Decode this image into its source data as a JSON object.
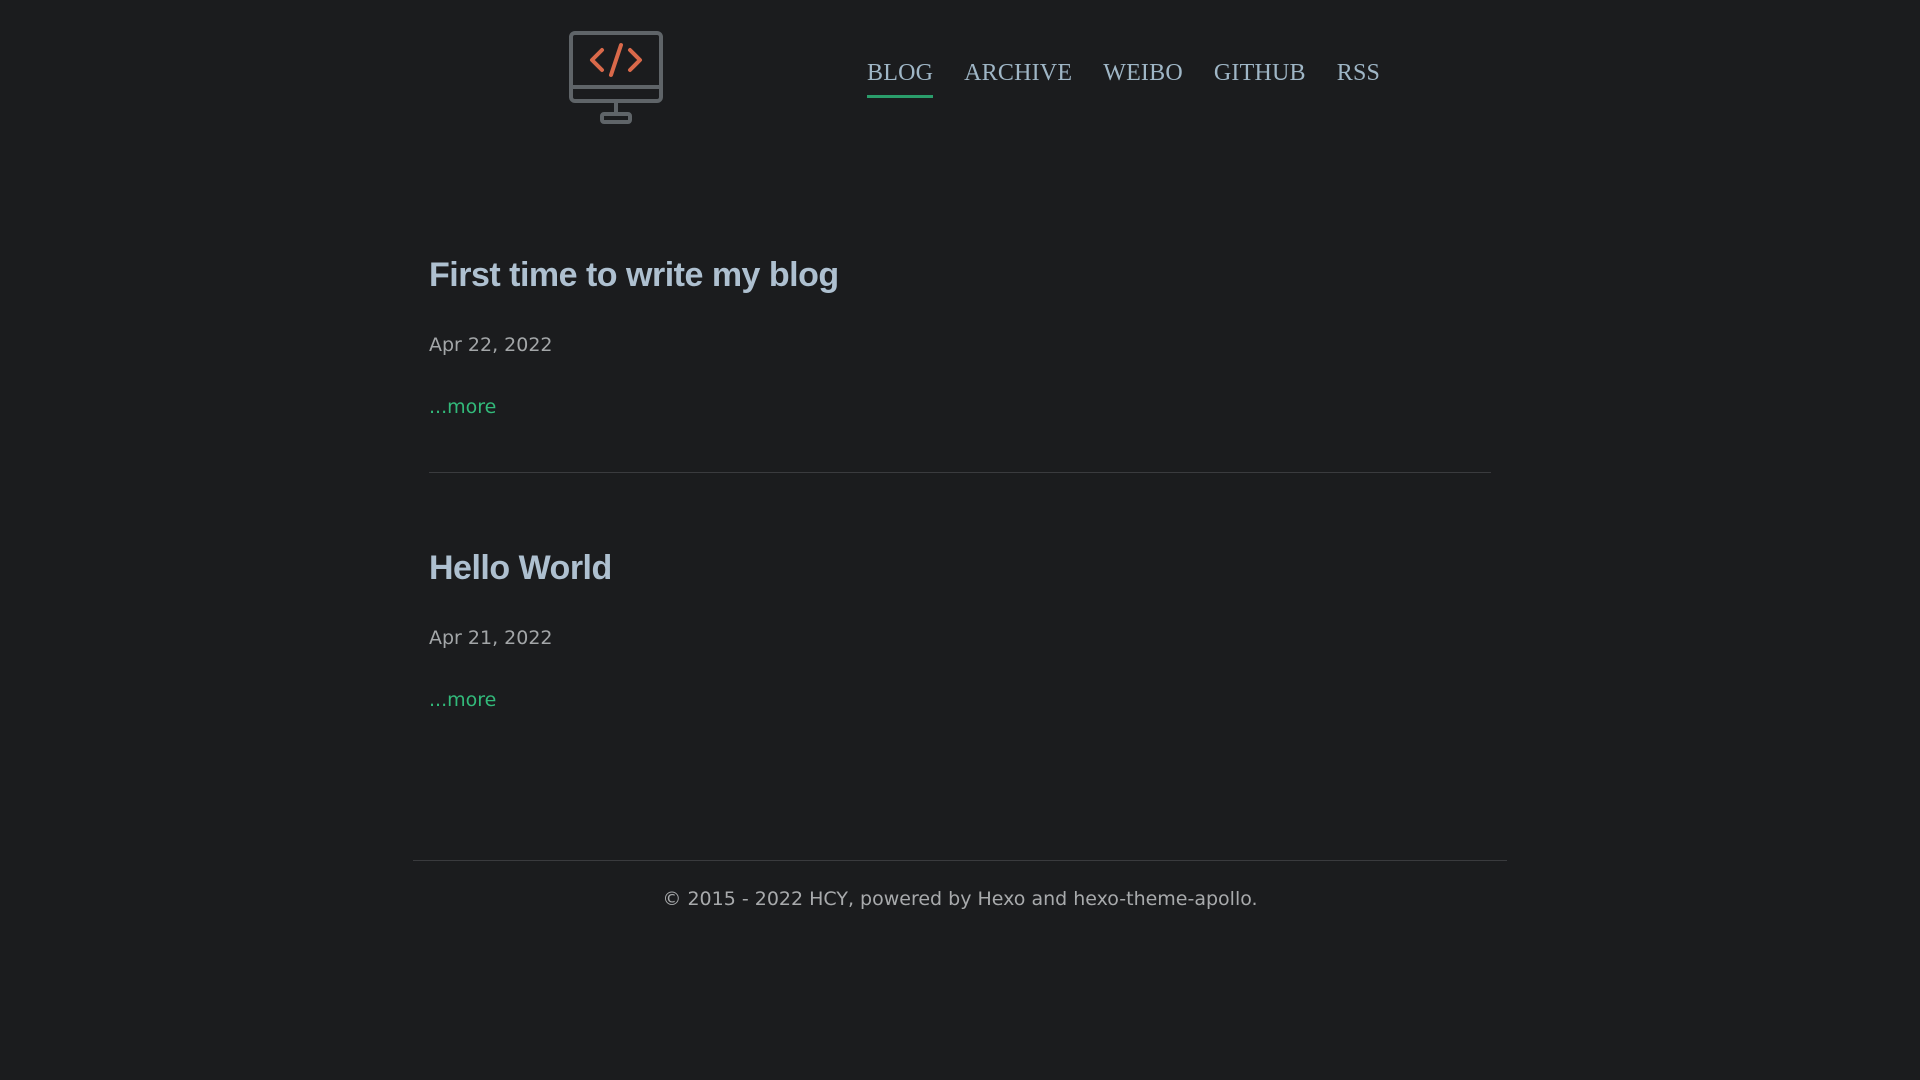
{
  "logo": {
    "icon": "code-monitor-icon",
    "accent": "#d9694a",
    "frame": "#5f6468"
  },
  "nav": {
    "items": [
      {
        "label": "BLOG",
        "active": true
      },
      {
        "label": "ARCHIVE",
        "active": false
      },
      {
        "label": "WEIBO",
        "active": false
      },
      {
        "label": "GITHUB",
        "active": false
      },
      {
        "label": "RSS",
        "active": false
      }
    ]
  },
  "posts": [
    {
      "title": "First time to write my blog",
      "date": "Apr 22, 2022",
      "more": "...more"
    },
    {
      "title": "Hello World",
      "date": "Apr 21, 2022",
      "more": "...more"
    }
  ],
  "footer": {
    "text": "© 2015 - 2022 HCY, powered by Hexo and hexo-theme-apollo."
  },
  "colors": {
    "background": "#1b1c1e",
    "link": "#32b97a",
    "active_underline": "#2a9d6b"
  }
}
